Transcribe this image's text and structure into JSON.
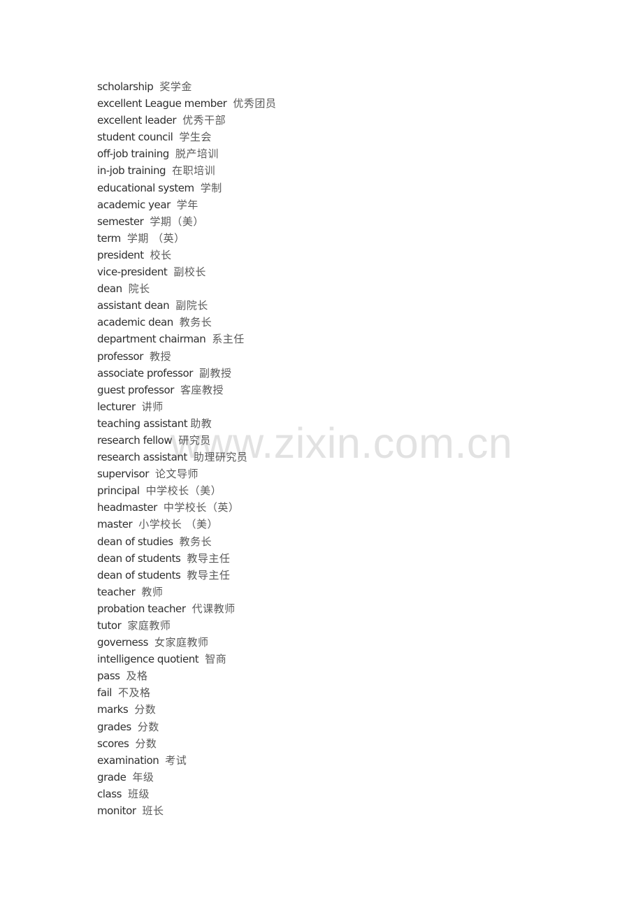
{
  "document": {
    "watermark": "www.zixin.com.cn",
    "entries": [
      {
        "en": "scholarship",
        "zh": "奖学金"
      },
      {
        "en": "excellent League member",
        "zh": "优秀团员"
      },
      {
        "en": "excellent leader",
        "zh": "优秀干部"
      },
      {
        "en": "student council",
        "zh": "学生会"
      },
      {
        "en": "off-job training",
        "zh": "脱产培训"
      },
      {
        "en": "in-job training",
        "zh": "在职培训"
      },
      {
        "en": "educational system",
        "zh": "学制"
      },
      {
        "en": "academic year",
        "zh": "学年"
      },
      {
        "en": "semester",
        "zh": "学期（美）"
      },
      {
        "en": "term",
        "zh": "学期 （英）"
      },
      {
        "en": "president",
        "zh": "校长"
      },
      {
        "en": "vice-president",
        "zh": "副校长"
      },
      {
        "en": "dean",
        "zh": "院长"
      },
      {
        "en": "assistant dean",
        "zh": "副院长"
      },
      {
        "en": "academic dean",
        "zh": "教务长"
      },
      {
        "en": "department chairman",
        "zh": "系主任"
      },
      {
        "en": "professor",
        "zh": "教授"
      },
      {
        "en": "associate professor",
        "zh": "副教授"
      },
      {
        "en": "guest professor",
        "zh": "客座教授"
      },
      {
        "en": "lecturer",
        "zh": "讲师"
      },
      {
        "en": "teaching assistant",
        "zh": "助教"
      },
      {
        "en": "research fellow",
        "zh": "研究员"
      },
      {
        "en": "research assistant",
        "zh": "助理研究员"
      },
      {
        "en": "supervisor",
        "zh": "论文导师"
      },
      {
        "en": "principal",
        "zh": "中学校长（美）"
      },
      {
        "en": "headmaster",
        "zh": "中学校长（英）"
      },
      {
        "en": "master",
        "zh": "小学校长 （美）"
      },
      {
        "en": "dean of studies",
        "zh": "教务长"
      },
      {
        "en": "dean of students",
        "zh": "教导主任"
      },
      {
        "en": "dean of students",
        "zh": "教导主任"
      },
      {
        "en": "teacher",
        "zh": "教师"
      },
      {
        "en": "probation teacher",
        "zh": "代课教师"
      },
      {
        "en": "tutor",
        "zh": "家庭教师"
      },
      {
        "en": "governess",
        "zh": "女家庭教师"
      },
      {
        "en": "intelligence quotient",
        "zh": "智商"
      },
      {
        "en": "pass",
        "zh": "及格"
      },
      {
        "en": "fail",
        "zh": "不及格"
      },
      {
        "en": "marks",
        "zh": "分数"
      },
      {
        "en": "grades",
        "zh": "分数"
      },
      {
        "en": "scores",
        "zh": "分数"
      },
      {
        "en": "examination",
        "zh": "考试"
      },
      {
        "en": "grade",
        "zh": "年级"
      },
      {
        "en": "class",
        "zh": "班级"
      },
      {
        "en": "monitor",
        "zh": "班长"
      }
    ]
  }
}
